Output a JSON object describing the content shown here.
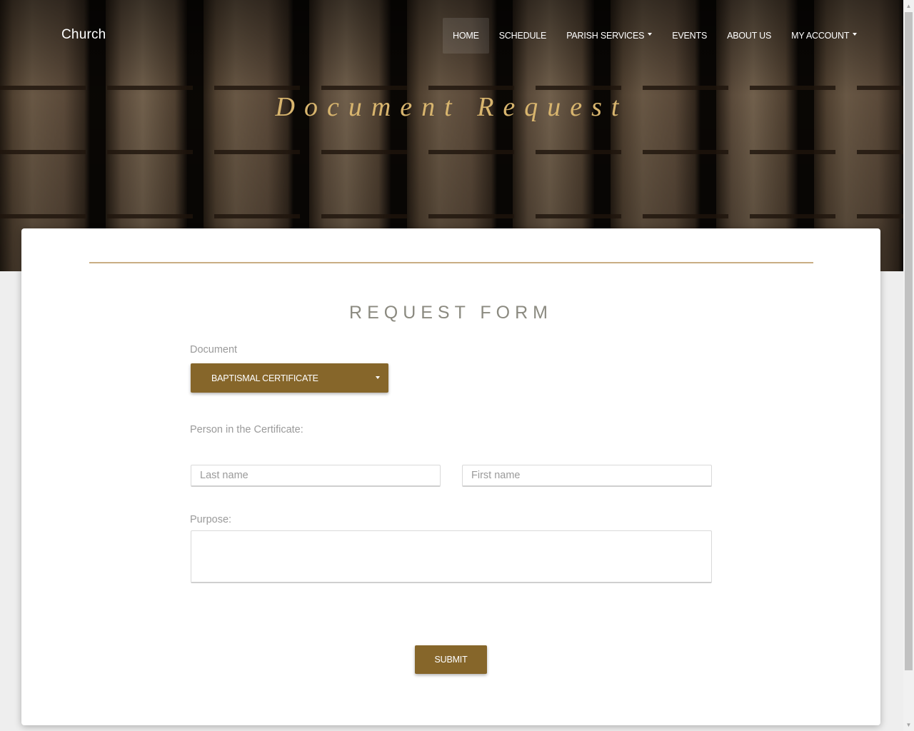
{
  "brand": "Church",
  "nav": {
    "items": [
      {
        "label": "HOME",
        "active": true,
        "dropdown": false
      },
      {
        "label": "SCHEDULE",
        "active": false,
        "dropdown": false
      },
      {
        "label": "PARISH SERVICES",
        "active": false,
        "dropdown": true
      },
      {
        "label": "EVENTS",
        "active": false,
        "dropdown": false
      },
      {
        "label": "ABOUT US",
        "active": false,
        "dropdown": false
      },
      {
        "label": "MY ACCOUNT",
        "active": false,
        "dropdown": true
      }
    ]
  },
  "hero": {
    "title": "Document Request"
  },
  "form": {
    "title": "REQUEST FORM",
    "document_label": "Document",
    "document_selected": "BAPTISMAL CERTIFICATE",
    "person_label": "Person in the Certificate:",
    "last_name": {
      "placeholder": "Last name",
      "value": ""
    },
    "first_name": {
      "placeholder": "First name",
      "value": ""
    },
    "purpose_label": "Purpose:",
    "purpose_value": "",
    "submit_label": "SUBMIT"
  },
  "colors": {
    "accent": "#86662a",
    "hero_title": "#d8b56e",
    "divider": "#c9ad83"
  }
}
